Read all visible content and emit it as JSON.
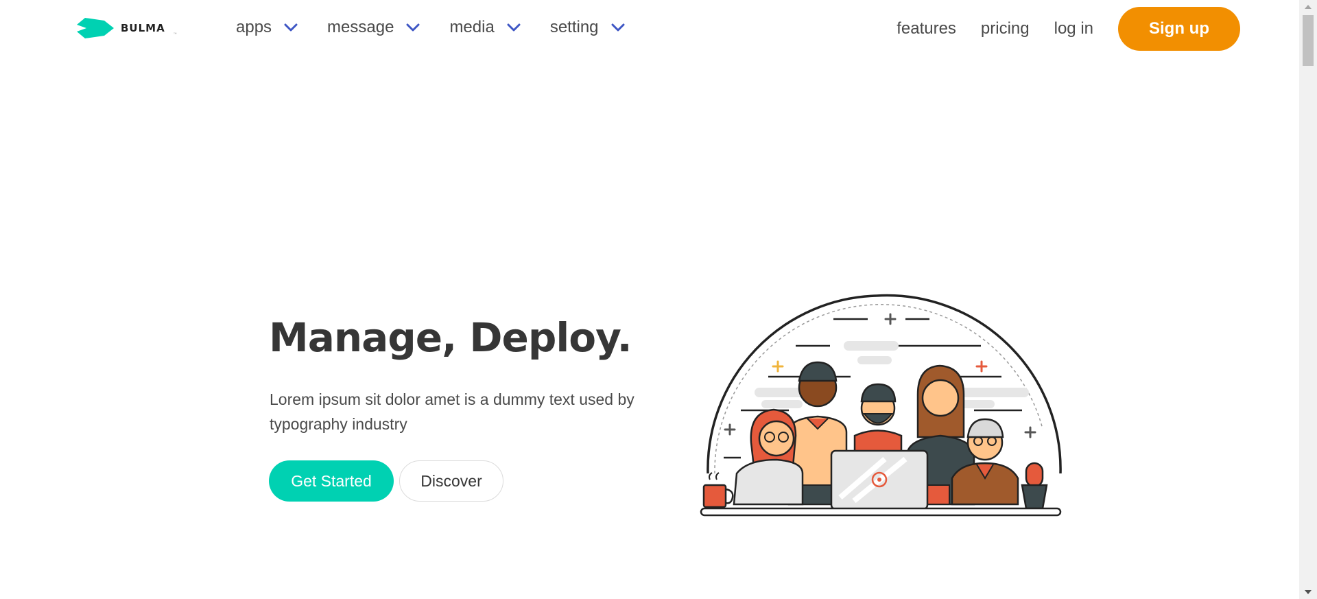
{
  "brand": {
    "name": "BULMA",
    "tm": "™",
    "accent": "#00d1b2"
  },
  "nav": {
    "menus": [
      {
        "label": "apps",
        "icon": "chevron-down-icon"
      },
      {
        "label": "message",
        "icon": "chevron-down-icon"
      },
      {
        "label": "media",
        "icon": "chevron-down-icon"
      },
      {
        "label": "setting",
        "icon": "chevron-down-icon"
      }
    ],
    "links": {
      "features": "features",
      "pricing": "pricing",
      "login": "log in"
    },
    "signup_label": "Sign up",
    "signup_color": "#f28f01",
    "chevron_color": "#3e56c4"
  },
  "hero": {
    "title": "Manage, Deploy.",
    "text": "Lorem ipsum sit dolor amet is a dummy text used by typography industry",
    "primary_label": "Get Started",
    "secondary_label": "Discover",
    "illustration": "team-at-laptop-illustration"
  }
}
